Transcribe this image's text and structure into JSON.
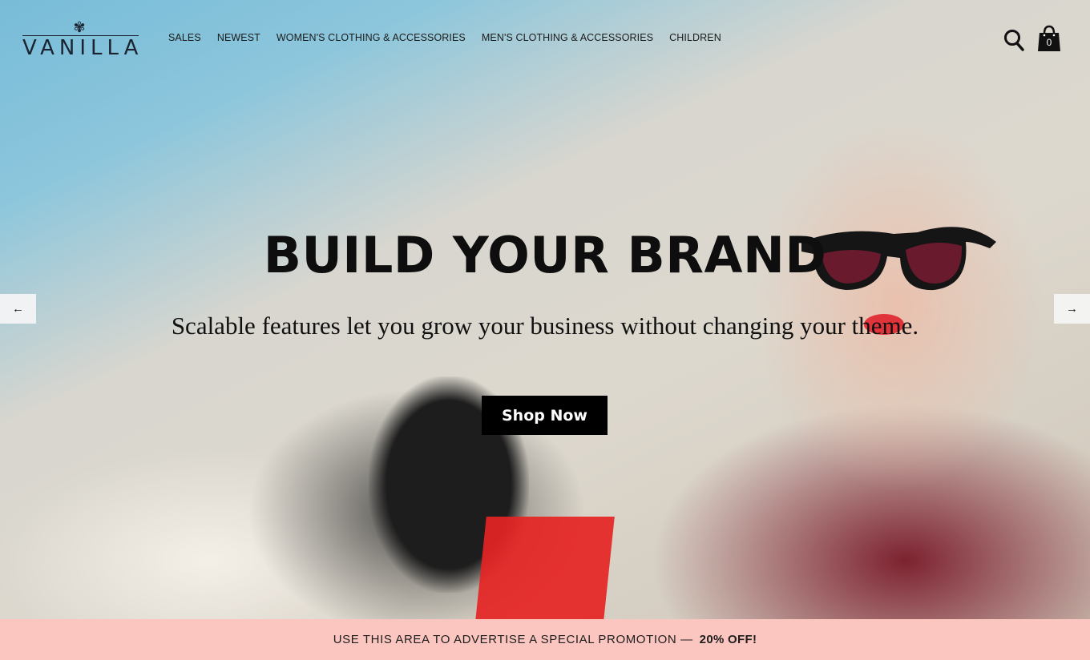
{
  "brand": {
    "name": "VANILLA",
    "mark_icon": "flower-logo-icon"
  },
  "nav": {
    "items": [
      {
        "label": "SALES"
      },
      {
        "label": "NEWEST"
      },
      {
        "label": "WOMEN'S CLOTHING & ACCESSORIES"
      },
      {
        "label": "MEN'S CLOTHING & ACCESSORIES"
      },
      {
        "label": "CHILDREN"
      }
    ]
  },
  "header_icons": {
    "search": "search-icon",
    "cart": "shopping-bag-icon",
    "cart_count": "0"
  },
  "hero": {
    "title": "BUILD YOUR BRAND",
    "subtitle": "Scalable features let you grow your business without changing your theme.",
    "cta_label": "Shop Now",
    "prev_arrow": "←",
    "next_arrow": "→"
  },
  "promo": {
    "text": "USE THIS AREA TO ADVERTISE A SPECIAL PROMOTION —",
    "highlight": "20% OFF!",
    "background": "#fbc5c0"
  }
}
